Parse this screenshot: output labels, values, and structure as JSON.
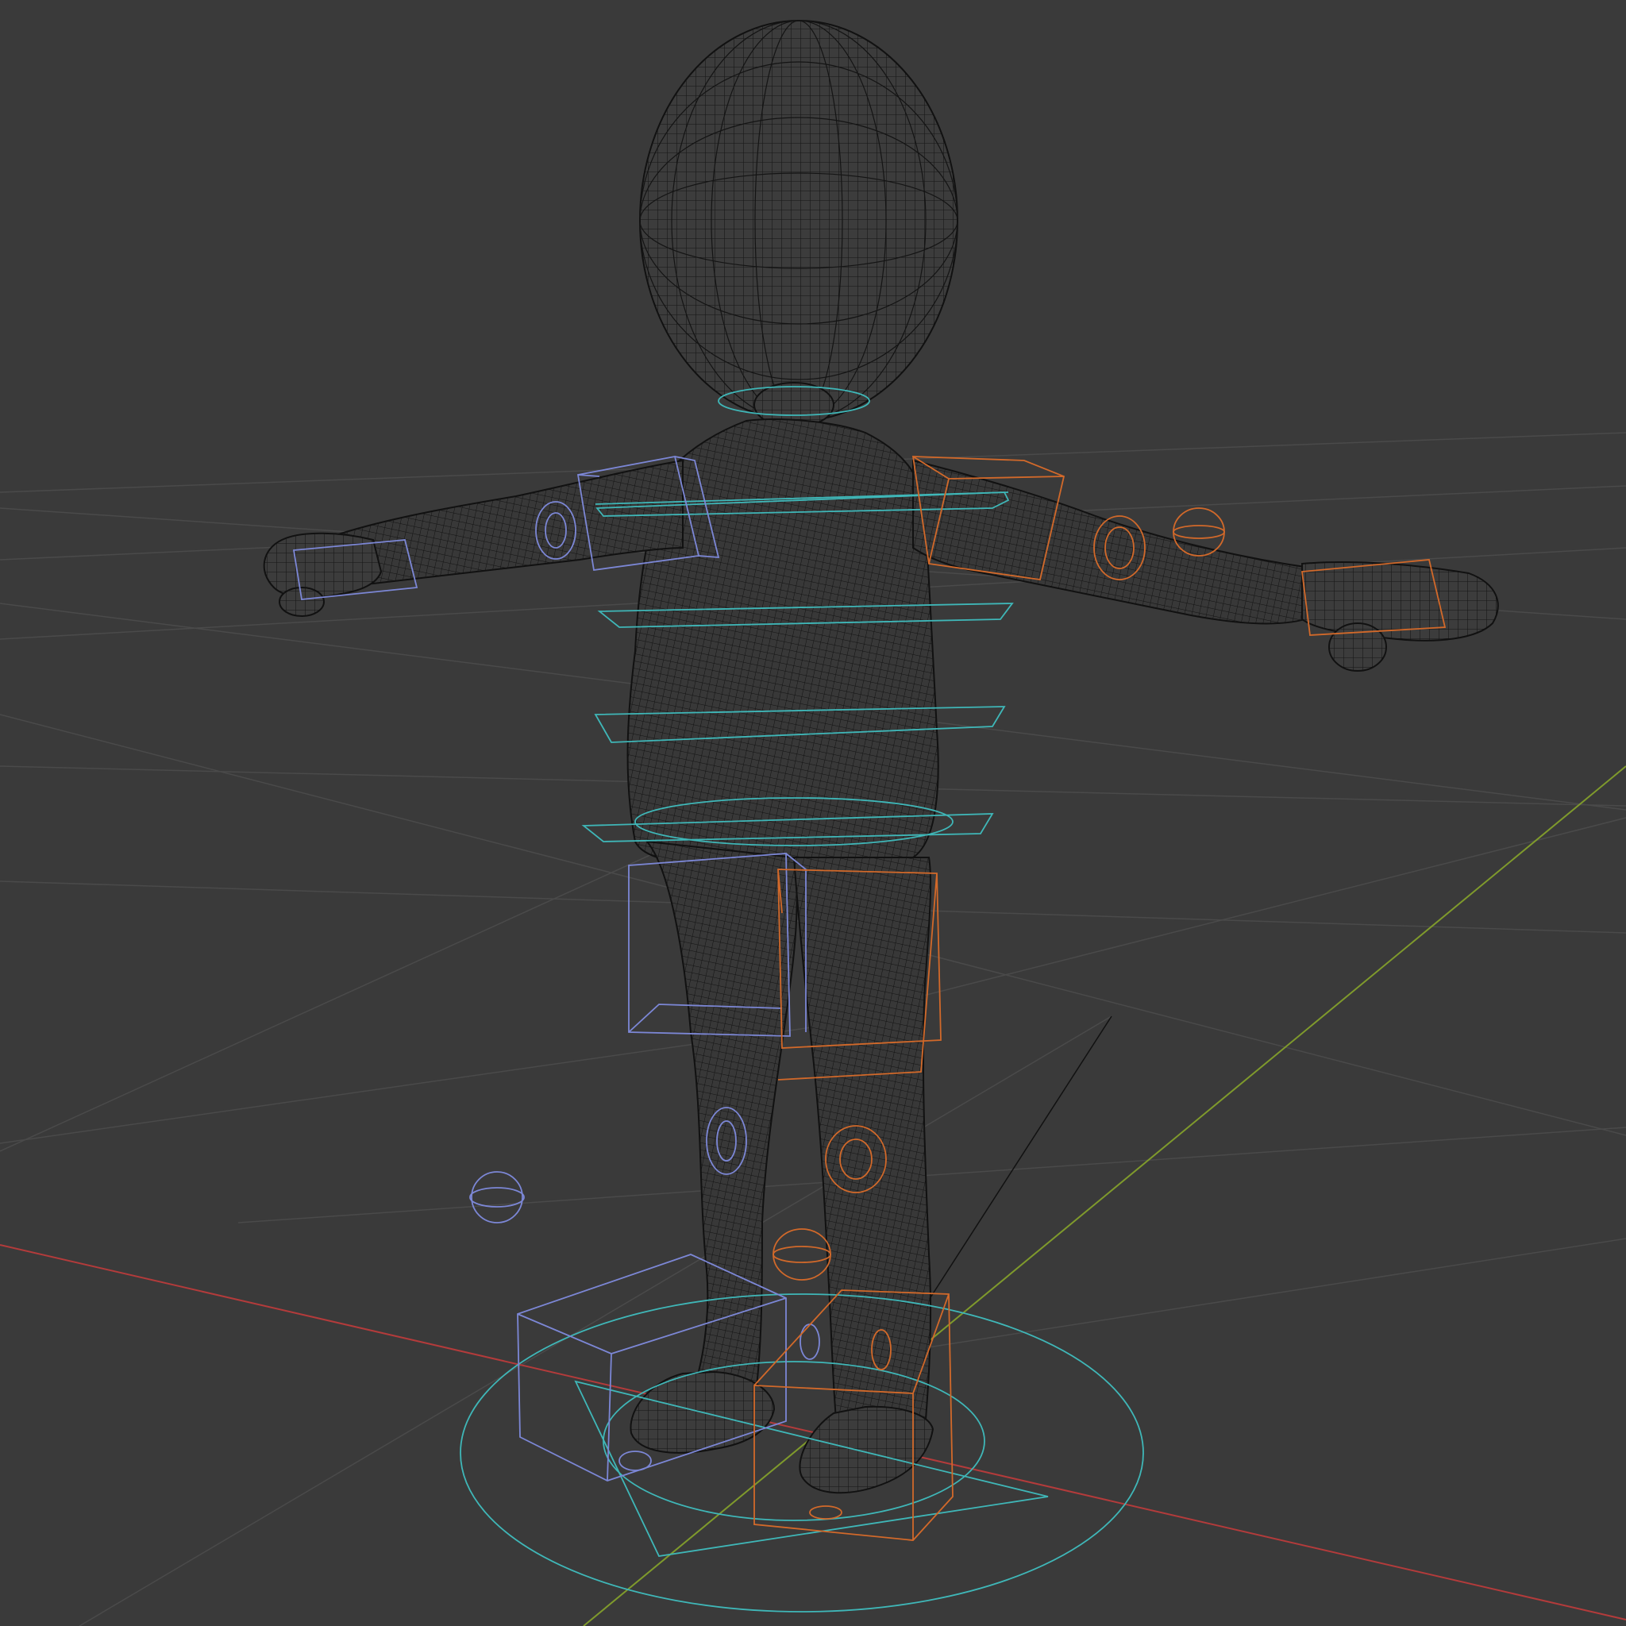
{
  "viewport": {
    "background": "#3a3a3a",
    "mode": "wireframe",
    "colors": {
      "grid": "#4a4a4a",
      "x_axis": "#b33b3b",
      "y_axis": "#7f9a2c",
      "mesh": "#151515",
      "control_center": "#3fb7b8",
      "control_left": "#7c87d6",
      "control_right": "#d2692a"
    }
  }
}
